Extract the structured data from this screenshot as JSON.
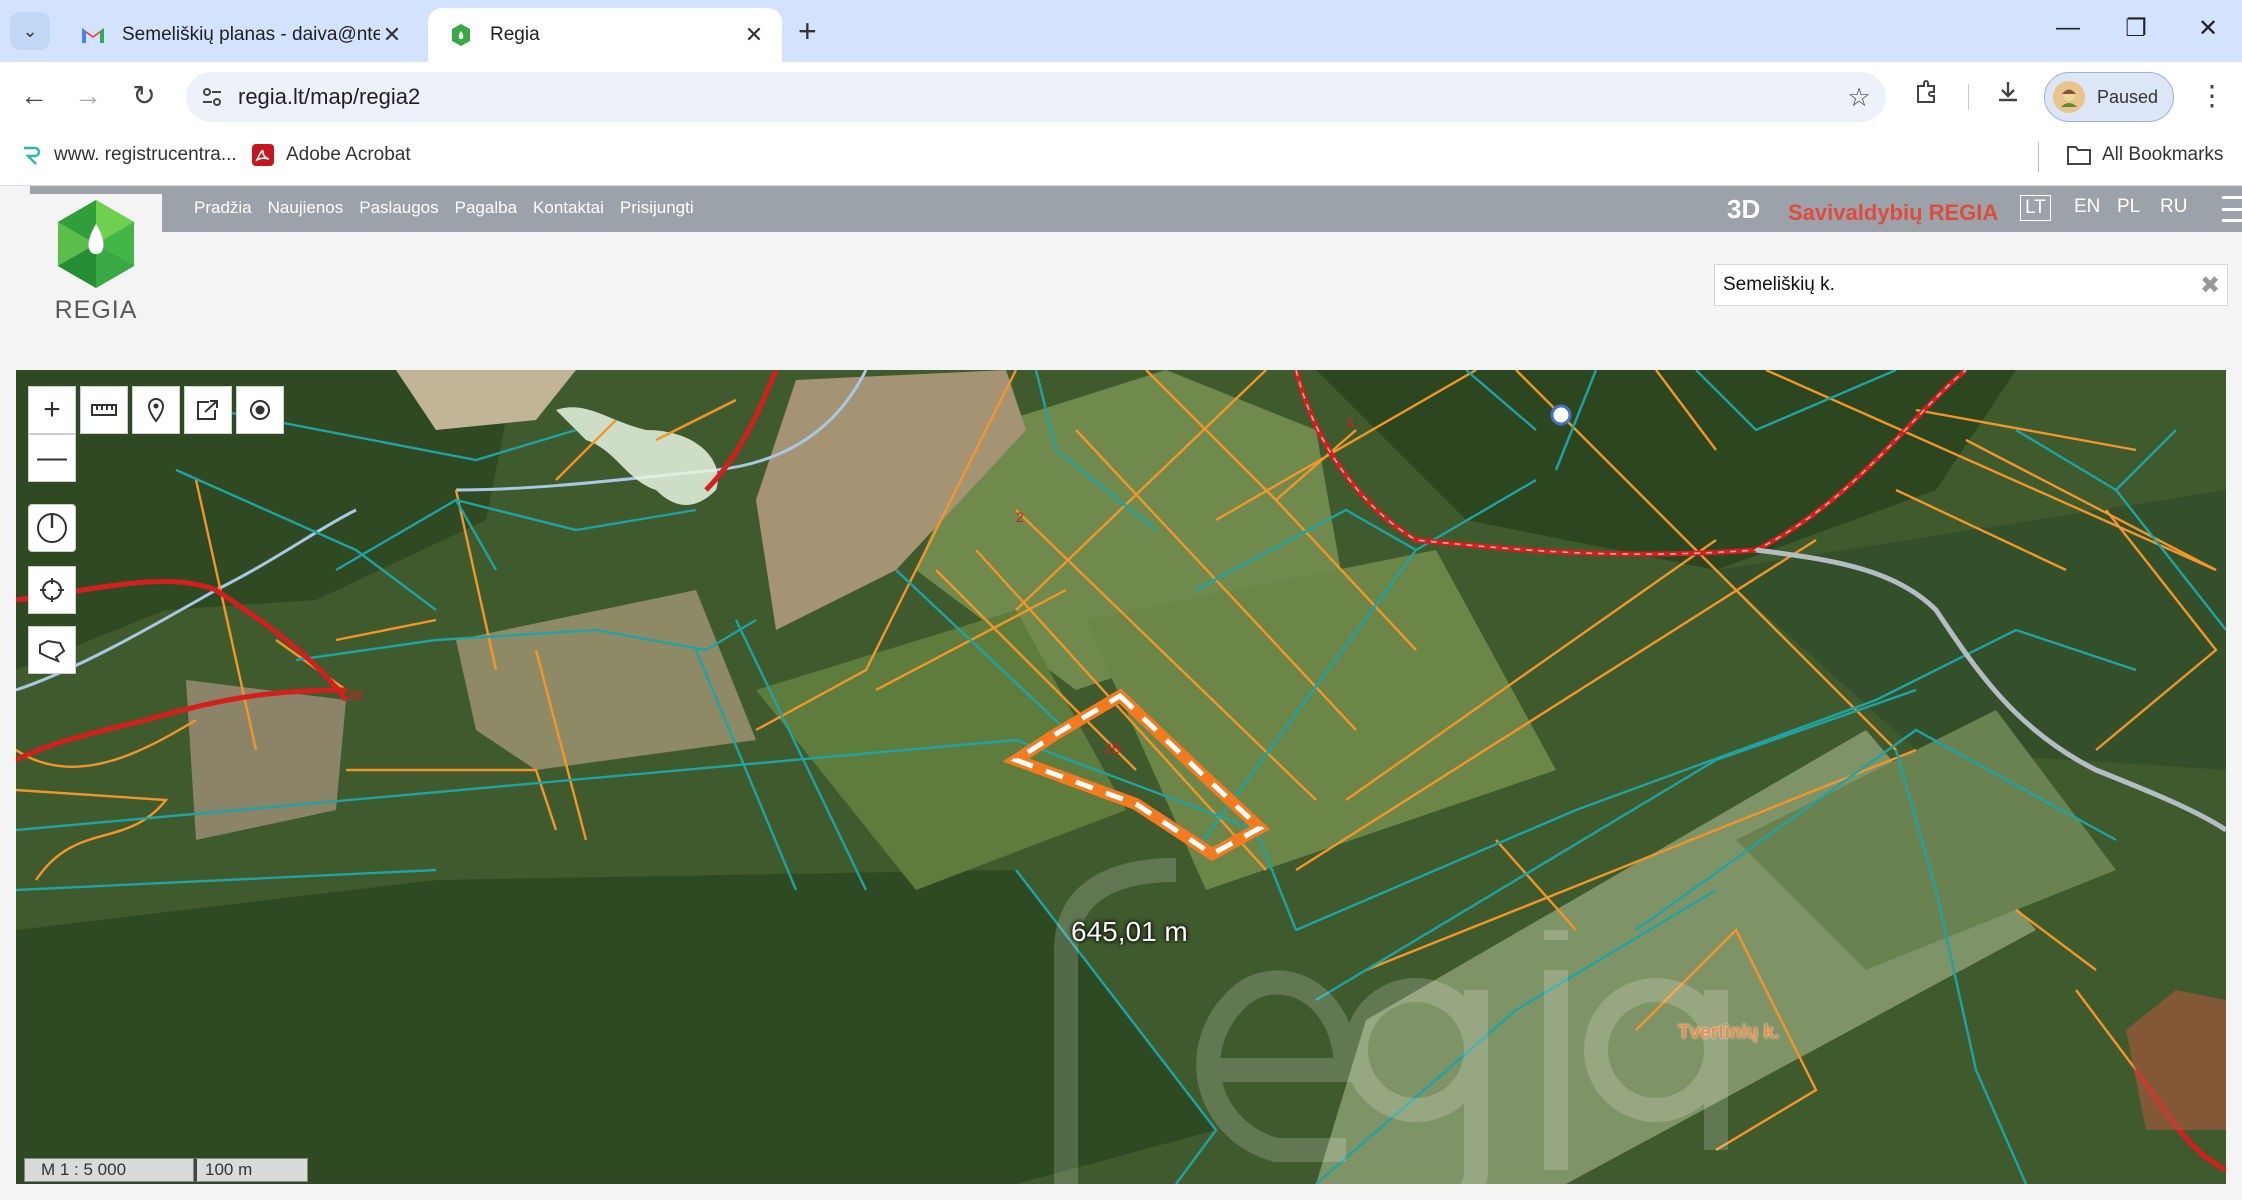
{
  "browser": {
    "tabs": [
      {
        "title": "Semeliškių planas - daiva@ntek",
        "icon": "gmail-icon",
        "active": false
      },
      {
        "title": "Regia",
        "icon": "regia-favicon",
        "active": true
      }
    ],
    "url": "regia.lt/map/regia2",
    "profile_status": "Paused",
    "bookmarks": [
      {
        "label": "www. registrucentra...",
        "icon": "registrucentras-icon"
      },
      {
        "label": "Adobe Acrobat",
        "icon": "acrobat-icon"
      }
    ],
    "all_bookmarks_label": "All Bookmarks"
  },
  "site": {
    "logo_text": "REGIA",
    "menu": [
      "Pradžia",
      "Naujienos",
      "Paslaugos",
      "Pagalba",
      "Kontaktai",
      "Prisijungti"
    ],
    "mode_3d": "3D",
    "brand": "Savivaldybių REGIA",
    "languages": [
      "LT",
      "EN",
      "PL",
      "RU"
    ],
    "active_language": "LT",
    "search": {
      "value": "Semeliškių k."
    }
  },
  "map": {
    "measurement_label": "645,01 m",
    "plot_labels": [
      "2B",
      "2",
      "3",
      "2B"
    ],
    "place_label": "Tvertinių k.",
    "watermark": "regia",
    "scale_ratio": "M 1 : 5 000",
    "scale_bar": "100 m",
    "tools": [
      "zoom-in",
      "zoom-out",
      "measure-distance",
      "place-marker",
      "share",
      "locate",
      "compass",
      "target",
      "draw-area"
    ]
  }
}
